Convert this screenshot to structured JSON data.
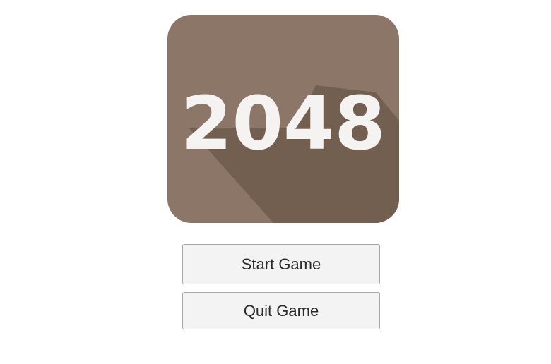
{
  "logo": {
    "text": "2048",
    "icon": "2048-logo-tile",
    "tile_color": "#8c7667",
    "shadow_color": "#735f50",
    "text_color": "#f5f3f1"
  },
  "menu": {
    "start_label": "Start Game",
    "quit_label": "Quit Game"
  }
}
